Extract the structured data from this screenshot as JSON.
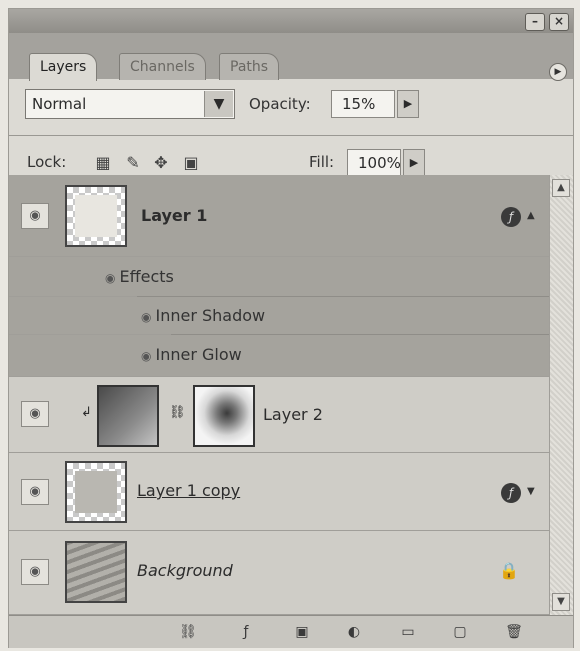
{
  "panel": {
    "tabs": [
      "Layers",
      "Channels",
      "Paths"
    ],
    "blend_mode": "Normal",
    "opacity_label": "Opacity:",
    "opacity_value": "15%",
    "lock_label": "Lock:",
    "fill_label": "Fill:",
    "fill_value": "100%"
  },
  "layers": [
    {
      "name": "Layer 1",
      "selected": true,
      "has_effects": true
    },
    {
      "name": "Layer 2",
      "has_mask": true
    },
    {
      "name": "Layer 1 copy",
      "has_effects": true
    },
    {
      "name": "Background",
      "locked": true
    }
  ],
  "effects": {
    "header": "Effects",
    "items": [
      "Inner Shadow",
      "Inner Glow"
    ]
  },
  "icons": {
    "fx": "fx-badge-icon",
    "lock": "lock-icon",
    "eye": "eye-icon",
    "link": "link-icon",
    "menu": "panel-menu-icon"
  },
  "colors": {
    "selected_row": "#a5a39d",
    "panel_bg": "#dcdad4",
    "tab_bar": "#a4a29d"
  }
}
